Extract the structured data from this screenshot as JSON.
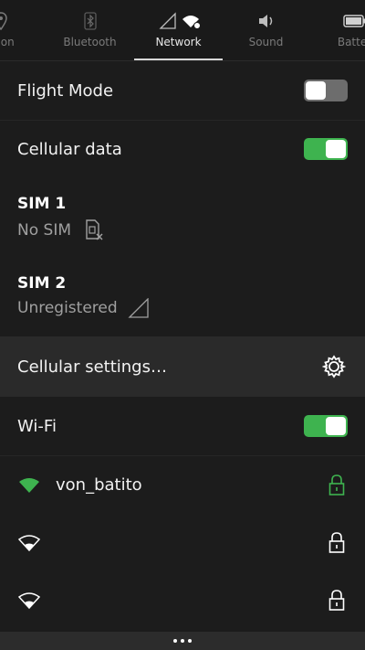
{
  "tabs": [
    {
      "label": "ation",
      "icon": "location-icon"
    },
    {
      "label": "Bluetooth",
      "icon": "bluetooth-icon"
    },
    {
      "label": "Network",
      "icon": "network-icon",
      "active": true
    },
    {
      "label": "Sound",
      "icon": "sound-icon"
    },
    {
      "label": "Batter",
      "icon": "battery-icon"
    }
  ],
  "flight_mode": {
    "label": "Flight Mode",
    "enabled": false
  },
  "cellular_data": {
    "label": "Cellular data",
    "enabled": true
  },
  "sim1": {
    "title": "SIM 1",
    "status": "No SIM",
    "icon": "no-sim-icon"
  },
  "sim2": {
    "title": "SIM 2",
    "status": "Unregistered",
    "icon": "signal-empty-icon"
  },
  "cellular_settings": {
    "label": "Cellular settings…",
    "icon": "gear-icon"
  },
  "wifi": {
    "label": "Wi-Fi",
    "enabled": true
  },
  "networks": [
    {
      "name": "von_batito",
      "connected": true,
      "secured": true
    },
    {
      "name": "",
      "connected": false,
      "secured": true
    },
    {
      "name": "",
      "connected": false,
      "secured": true
    }
  ],
  "colors": {
    "accent_green": "#3eb34f",
    "background": "#1c1c1c",
    "toggle_off": "#6d6d6d"
  }
}
